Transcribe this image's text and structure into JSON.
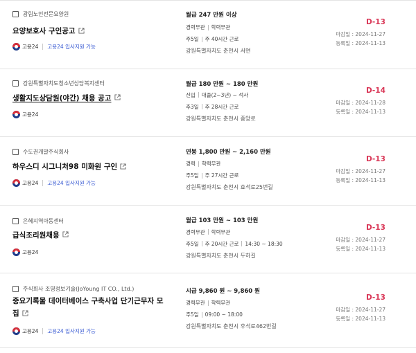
{
  "listings": [
    {
      "company": "광림노인전문요양원",
      "title": "요양보호사 구인공고",
      "provider": "고용24",
      "support": "고용24 입사지원 가능",
      "pay": "월급 247 만원 이상",
      "meta1": [
        "경력무관",
        "학력무관"
      ],
      "meta2": [
        "주5일",
        "주 40시간 근로"
      ],
      "location": "강원특별자치도 춘천시 서면",
      "dday": "D-13",
      "deadline": "마감일 : 2024-11-27",
      "registered": "등록일 : 2024-11-13"
    },
    {
      "company": "강원특별자치도청소년상담복지센터",
      "title": "생활지도상담원(야간) 채용 공고",
      "provider": "고용24",
      "support": "",
      "pay": "월급 180 만원 ~ 180 만원",
      "meta1": [
        "신입",
        "대졸(2~3년) ~ 석사"
      ],
      "meta2": [
        "주3일",
        "주 28시간 근로"
      ],
      "location": "강원특별자치도 춘천시 중앙로",
      "dday": "D-14",
      "deadline": "마감일 : 2024-11-28",
      "registered": "등록일 : 2024-11-13"
    },
    {
      "company": "수도권개발주식회사",
      "title": "하우스디 시그니처98 미화원 구인",
      "provider": "고용24",
      "support": "고용24 입사지원 가능",
      "pay": "연봉 1,800 만원 ~ 2,160 만원",
      "meta1": [
        "경력",
        "학력무관"
      ],
      "meta2": [
        "주5일",
        "주 27시간 근로"
      ],
      "location": "강원특별자치도 춘천시 효석로25번길",
      "dday": "D-13",
      "deadline": "마감일 : 2024-11-27",
      "registered": "등록일 : 2024-11-13"
    },
    {
      "company": "은혜지역아동센터",
      "title": "급식조리원채용",
      "provider": "고용24",
      "support": "",
      "pay": "월급 103 만원 ~ 103 만원",
      "meta1": [
        "경력무관",
        "학력무관"
      ],
      "meta2": [
        "주5일",
        "주 20시간 근로",
        "14:30 ~ 18:30"
      ],
      "location": "강원특별자치도 춘천시 두하길",
      "dday": "D-13",
      "deadline": "마감일 : 2024-11-27",
      "registered": "등록일 : 2024-11-13"
    },
    {
      "company": "주식회사 조영정보기술(JoYoung IT CO., Ltd.)",
      "title_line1": "중요기록물 데이터베이스 구축사업 단기근무자 모",
      "title_line2": "집",
      "provider": "고용24",
      "support": "고용24 입사지원 가능",
      "pay": "시급 9,860 원 ~ 9,860 원",
      "meta1": [
        "경력무관",
        "학력무관"
      ],
      "meta2": [
        "주5일",
        "09:00 ~ 18:00"
      ],
      "location": "강원특별자치도 춘천시 후석로462번길",
      "dday": "D-13",
      "deadline": "마감일 : 2024-11-27",
      "registered": "등록일 : 2024-11-13"
    }
  ]
}
